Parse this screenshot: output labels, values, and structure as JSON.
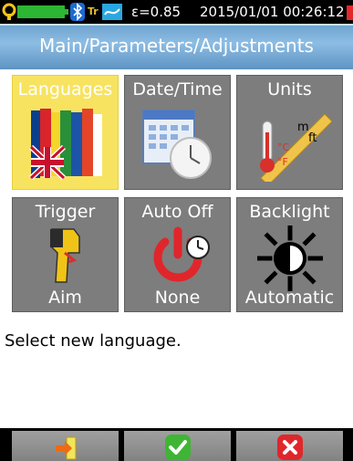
{
  "status": {
    "emissivity": "ε=0.85",
    "datetime": "2015/01/01 00:26:12",
    "tr_label": "Tr"
  },
  "header": {
    "title": "Main/Parameters/Adjustments"
  },
  "tiles": [
    {
      "label": "Languages",
      "value": "",
      "icon": "flags-icon",
      "selected": true
    },
    {
      "label": "Date/Time",
      "value": "",
      "icon": "calendar-clock-icon"
    },
    {
      "label": "Units",
      "value": "",
      "icon": "thermometer-ruler-icon",
      "icon_text": {
        "m": "m",
        "ft": "ft",
        "c": "°C",
        "f": "°F"
      }
    },
    {
      "label": "Trigger",
      "value": "Aim",
      "icon": "camera-trigger-icon"
    },
    {
      "label": "Auto Off",
      "value": "None",
      "icon": "power-timer-icon"
    },
    {
      "label": "Backlight",
      "value": "Automatic",
      "icon": "brightness-icon"
    }
  ],
  "message": "Select new language.",
  "buttons": [
    {
      "icon": "exit-icon"
    },
    {
      "icon": "confirm-check-icon"
    },
    {
      "icon": "cancel-x-icon"
    }
  ],
  "colors": {
    "header": "#7fb2dc",
    "tile": "#7d7d7d",
    "tile_selected": "#f7e360",
    "confirm": "#3fb534",
    "cancel": "#e0262b",
    "exit": "#f06a12"
  }
}
